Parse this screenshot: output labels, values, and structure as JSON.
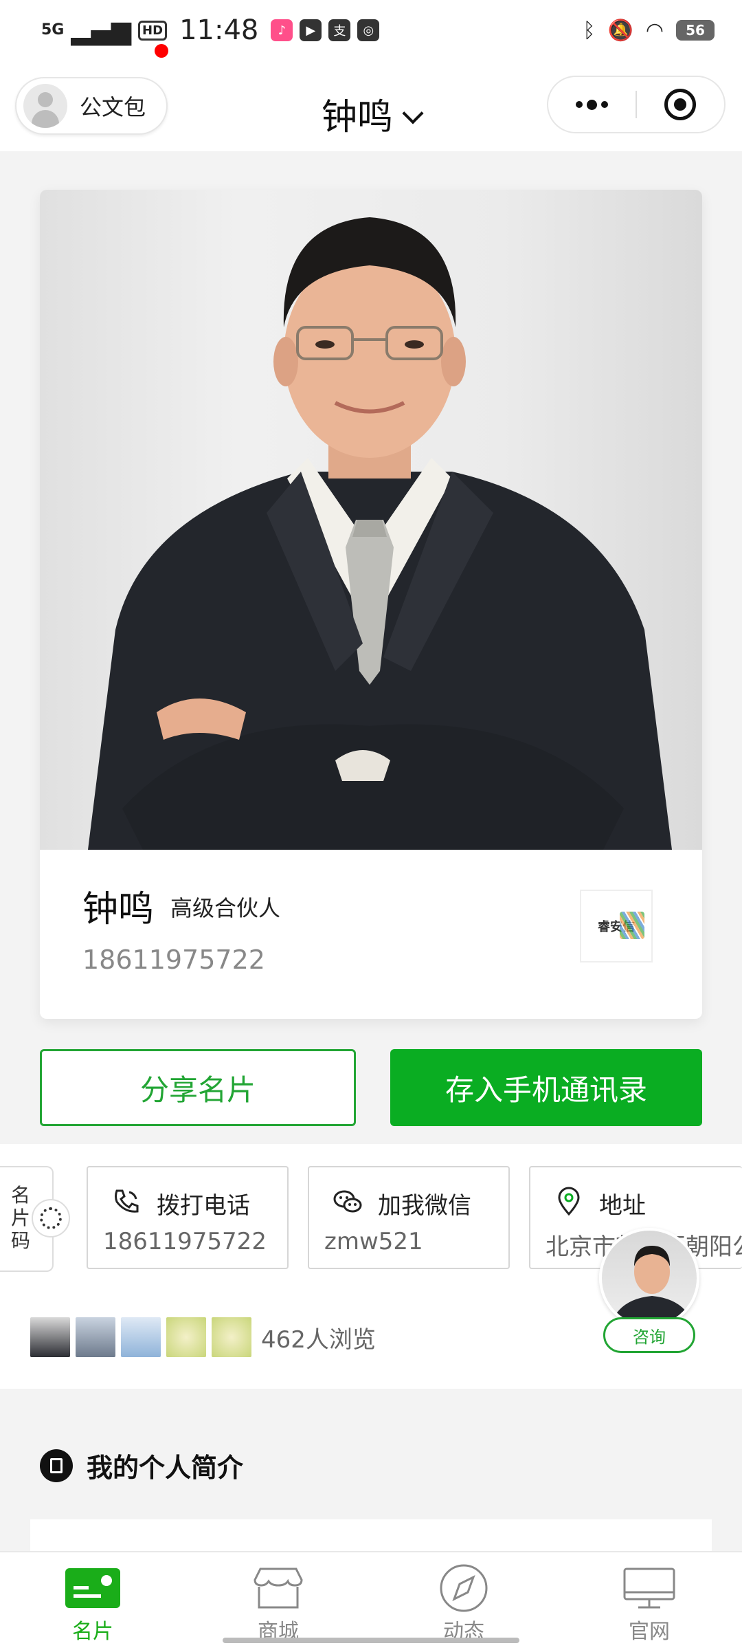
{
  "status_bar": {
    "network": "5G",
    "hd": "HD",
    "time": "11:48",
    "apps": [
      "lala",
      "play",
      "支",
      "app"
    ],
    "battery": "56"
  },
  "nav": {
    "wallet_label": "公文包",
    "title": "钟鸣"
  },
  "card": {
    "name": "钟鸣",
    "title": "高级合伙人",
    "phone": "18611975722",
    "company_logo_text": "睿安信"
  },
  "actions": {
    "share_label": "分享名片",
    "save_label": "存入手机通讯录"
  },
  "qr_tab": {
    "label": "名片码"
  },
  "contacts": [
    {
      "icon": "phone-icon",
      "label": "拨打电话",
      "value": "18611975722"
    },
    {
      "icon": "wechat-icon",
      "label": "加我微信",
      "value": "zmw521"
    },
    {
      "icon": "location-icon",
      "label": "地址",
      "value": "北京市朝阳区朝阳公"
    }
  ],
  "consult": {
    "label": "咨询"
  },
  "viewers": {
    "count_text": "462人浏览"
  },
  "intro": {
    "title": "我的个人简介"
  },
  "tabbar": [
    {
      "label": "名片",
      "icon": "card-icon",
      "active": true
    },
    {
      "label": "商城",
      "icon": "shop-icon",
      "active": false
    },
    {
      "label": "动态",
      "icon": "compass-icon",
      "active": false
    },
    {
      "label": "官网",
      "icon": "monitor-icon",
      "active": false
    }
  ],
  "colors": {
    "accent": "#0aad22",
    "accent_text": "#22a534"
  }
}
